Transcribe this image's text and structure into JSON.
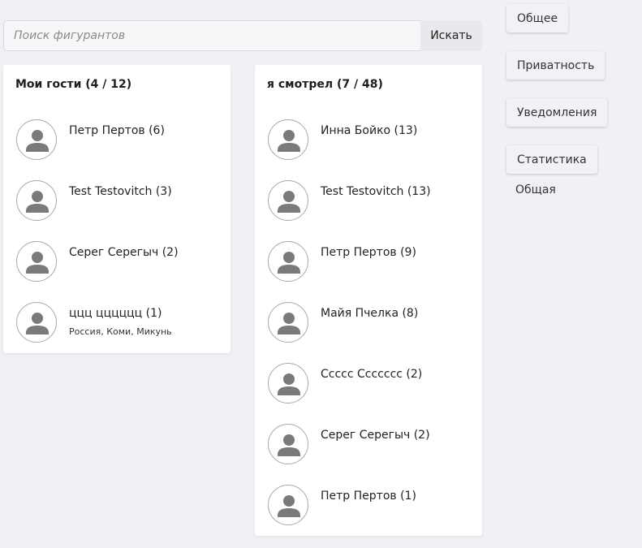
{
  "search": {
    "placeholder": "Поиск фигурантов",
    "button_label": "Искать"
  },
  "guests": {
    "title": "Мои гости (4 / 12)",
    "items": [
      {
        "name": "Петр Пертов (6)",
        "location": ""
      },
      {
        "name": "Test Testovitch (3)",
        "location": ""
      },
      {
        "name": "Серег Серегыч (2)",
        "location": ""
      },
      {
        "name": "ццц цццццц (1)",
        "location": "Россия, Коми, Микунь"
      }
    ]
  },
  "viewed": {
    "title": "я смотрел (7 / 48)",
    "items": [
      {
        "name": "Инна Бойко (13)"
      },
      {
        "name": "Test Testovitch (13)"
      },
      {
        "name": "Петр Пертов (9)"
      },
      {
        "name": "Майя Пчелка (8)"
      },
      {
        "name": "Ссссс Ссссссс (2)"
      },
      {
        "name": "Серег Серегыч (2)"
      },
      {
        "name": "Петр Пертов (1)"
      }
    ]
  },
  "sidebar": {
    "buttons": [
      {
        "label": "Общее"
      },
      {
        "label": "Приватность"
      },
      {
        "label": "Уведомления"
      },
      {
        "label": "Статистика"
      }
    ],
    "sub_items": [
      {
        "label": "Общая"
      }
    ]
  },
  "icons": {
    "avatar": "user-silhouette-icon"
  },
  "colors": {
    "background": "#f0f1f5",
    "card": "#ffffff",
    "avatar_silhouette": "#7a7a7a"
  }
}
